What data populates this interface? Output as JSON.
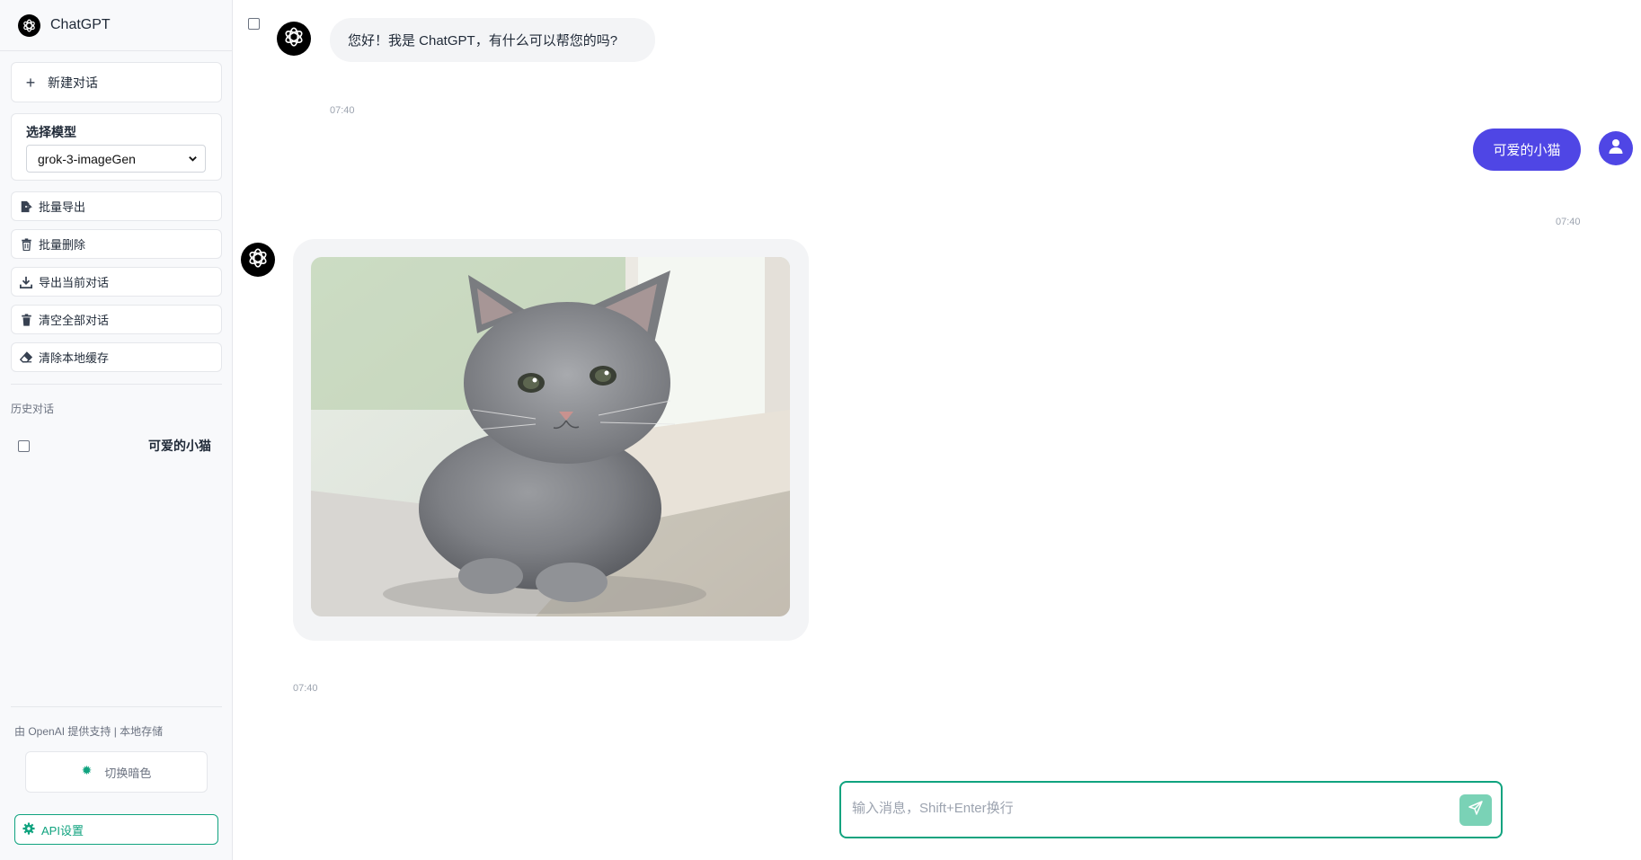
{
  "app": {
    "title": "ChatGPT"
  },
  "sidebar": {
    "new_chat_label": "新建对话",
    "model": {
      "label": "选择模型",
      "selected": "grok-3-imageGen"
    },
    "actions": [
      {
        "label": "批量导出",
        "icon": "file-export-icon"
      },
      {
        "label": "批量删除",
        "icon": "trash-icon"
      },
      {
        "label": "导出当前对话",
        "icon": "download-icon"
      },
      {
        "label": "清空全部对话",
        "icon": "trash-icon"
      },
      {
        "label": "清除本地缓存",
        "icon": "eraser-icon"
      }
    ],
    "history_label": "历史对话",
    "history": [
      {
        "title": "可爱的小猫",
        "checked": false
      }
    ],
    "footer_text": "由 OpenAI 提供支持 | 本地存储",
    "theme_toggle_label": "切换暗色",
    "api_settings_label": "API设置"
  },
  "chat": {
    "messages": [
      {
        "role": "assistant",
        "text": "您好！我是 ChatGPT，有什么可以帮您的吗?",
        "time": "07:40"
      },
      {
        "role": "user",
        "text": "可爱的小猫",
        "time": "07:40"
      },
      {
        "role": "assistant",
        "type": "image",
        "time": "07:40"
      }
    ]
  },
  "input": {
    "placeholder": "输入消息，Shift+Enter换行",
    "value": ""
  },
  "colors": {
    "accent": "#10a37f",
    "user_bubble": "#4f46e5",
    "send_button": "#7ad2b6"
  }
}
